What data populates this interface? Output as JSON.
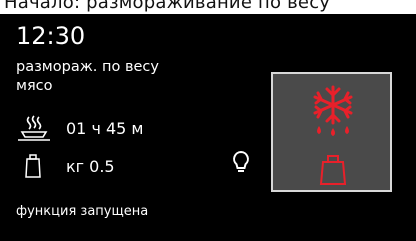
{
  "header_strip": {
    "text": "Начало: размораживание по весу"
  },
  "display": {
    "time": "12:30",
    "program_line1": "размораж. по весу",
    "program_line2": "мясо",
    "duration": "01 ч 45 м",
    "weight": "кг 0.5",
    "status": "функция запущена"
  },
  "icons": {
    "duration": "dish-steam-icon",
    "weight": "weight-icon",
    "lamp": "lightbulb-icon",
    "mode": "defrost-by-weight-icon"
  },
  "colors": {
    "background": "#000000",
    "text": "#ffffff",
    "accent": "#e8202a",
    "mode_box": "#4a4a4a"
  }
}
